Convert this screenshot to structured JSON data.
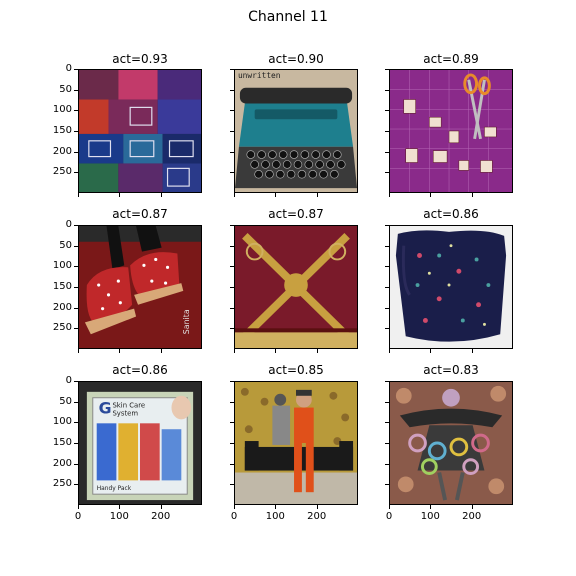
{
  "figure": {
    "title": "Channel 11"
  },
  "panels": [
    {
      "title": "act=0.93",
      "scene": "quilt",
      "colors": [
        "#6b2a4a",
        "#1a3a8a",
        "#c23a2a",
        "#2a6a4a"
      ]
    },
    {
      "title": "act=0.90",
      "scene": "typewriter",
      "caption": "unwritten",
      "colors": [
        "#1e7f8e",
        "#2b2b2b",
        "#c8b8a0"
      ]
    },
    {
      "title": "act=0.89",
      "scene": "craft-mat",
      "colors": [
        "#8a2a8a",
        "#e88a2a",
        "#f0e0d0"
      ]
    },
    {
      "title": "act=0.87",
      "scene": "clogs",
      "caption": "Sanita",
      "colors": [
        "#c0282a",
        "#7a1818",
        "#2a2a2a"
      ]
    },
    {
      "title": "act=0.87",
      "scene": "embroidery",
      "colors": [
        "#7a1a2a",
        "#c8a040",
        "#d0b060"
      ]
    },
    {
      "title": "act=0.86",
      "scene": "apron",
      "colors": [
        "#1a1e4a",
        "#f0f0f0",
        "#d04a6a"
      ]
    },
    {
      "title": "act=0.86",
      "scene": "skincare-box",
      "box_text": {
        "logo": "G",
        "line1": "Skin Care",
        "line2": "System",
        "footer": "Handy Pack"
      },
      "colors": [
        "#2a2a2a",
        "#d0d8e0",
        "#3a6ad0",
        "#e0b030",
        "#d04a4a"
      ]
    },
    {
      "title": "act=0.85",
      "scene": "fashion-room",
      "colors": [
        "#b89a3a",
        "#e0501a",
        "#1a1a1a"
      ]
    },
    {
      "title": "act=0.83",
      "scene": "patchwork-dress",
      "colors": [
        "#8a5a4a",
        "#2a2a2a",
        "#d0a0c0"
      ]
    }
  ],
  "axes": {
    "y_ticks": [
      "0",
      "50",
      "100",
      "150",
      "200",
      "250"
    ],
    "x_ticks": [
      "0",
      "100",
      "200"
    ]
  }
}
